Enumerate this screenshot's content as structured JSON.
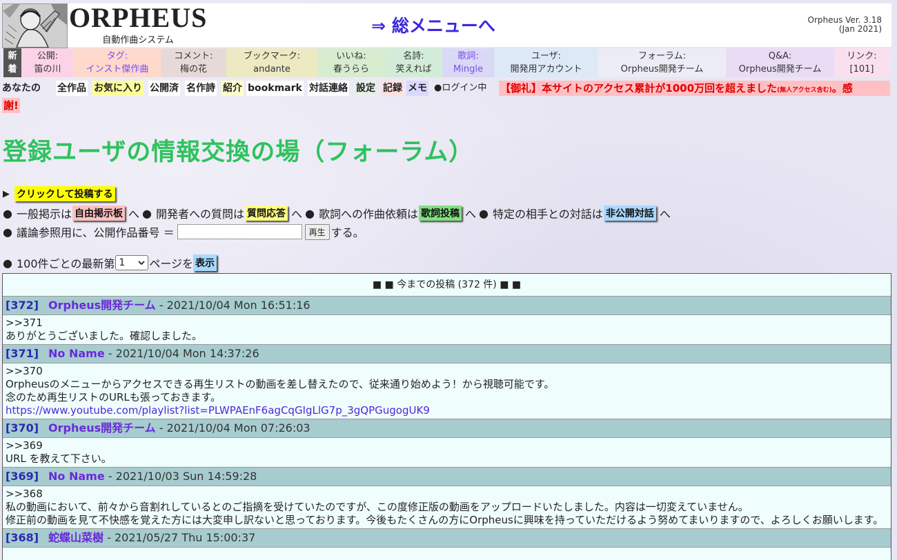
{
  "header": {
    "logo_text": "ORPHEUS",
    "logo_subtitle": "自動作曲システム",
    "total_menu_link": "⇒ 総メニューへ",
    "version_line1": "Orpheus Ver. 3.18",
    "version_line2": "(Jan 2021)"
  },
  "nav": {
    "new": {
      "label1": "新",
      "label2": "着"
    },
    "cells": [
      {
        "label": "公開:",
        "value": "笛の川",
        "bg": "#fcd3e6"
      },
      {
        "label": "タグ:",
        "value": "インスト傑作曲",
        "bg": "#ffd9cc",
        "label_color": "#7a4af0",
        "value_color": "#7a4af0"
      },
      {
        "label": "コメント:",
        "value": "梅の花",
        "bg": "#e8d9d9"
      },
      {
        "label": "ブックマーク:",
        "value": "andante",
        "bg": "#ede9c3"
      },
      {
        "label": "いいね:",
        "value": "春うらら",
        "bg": "#d8ecd0"
      },
      {
        "label": "名詩:",
        "value": "笑えれば",
        "bg": "#d3ecd7"
      },
      {
        "label": "歌詞:",
        "value": "Mingle",
        "bg": "#d9d9f5",
        "label_color": "#7a4af0",
        "value_color": "#7a4af0"
      },
      {
        "label": "ユーザ:",
        "value": "開発用アカウント",
        "bg": "#dde9f7"
      },
      {
        "label": "フォーラム:",
        "value": "Orpheus開発チーム",
        "bg": "#ececf5"
      },
      {
        "label": "Q&A:",
        "value": "Orpheus開発チーム",
        "bg": "#eadcf5"
      },
      {
        "label": "リンク:",
        "value": "[101]",
        "bg": "#fae0ee"
      }
    ]
  },
  "account": {
    "yours": "あなたの",
    "items": [
      {
        "label": "全作品",
        "bg": "#ffffff"
      },
      {
        "label": "お気に入り",
        "bg": "#ffff99"
      },
      {
        "label": "公開済",
        "bg": "#ffffff"
      },
      {
        "label": "名作詩",
        "bg": "#ffffff"
      },
      {
        "label": "紹介",
        "bg": "#ffffcc"
      },
      {
        "label": "bookmark",
        "bg": "#ffffff"
      },
      {
        "label": "対話連絡",
        "bg": "#ffffff"
      },
      {
        "label": "設定",
        "bg": "#e6f0e6"
      },
      {
        "label": "記録",
        "bg": "#ffe0e0"
      },
      {
        "label": "メモ",
        "bg": "#d9d9ff"
      }
    ],
    "login_status": "●ログイン中",
    "notice_main": "【御礼】本サイトのアクセス累計が1000万回を超えました",
    "notice_small": "(無人アクセス含む)",
    "notice_tail": "。感",
    "notice_line2": "謝!"
  },
  "page": {
    "title": "登録ユーザの情報交換の場（フォーラム）"
  },
  "post_link": {
    "arrow": "▶",
    "label": "クリックして投稿する"
  },
  "guide": {
    "bullet": "●",
    "t1": "一般掲示は",
    "tag_free": "自由掲示板",
    "t2": "へ",
    "t3": "開発者への質問は",
    "tag_qa": "質問応答",
    "t4": "へ",
    "t5": "歌詞への作曲依頼は",
    "tag_lyric": "歌詞投稿",
    "t6": "へ",
    "t7": "特定の相手との対話は",
    "tag_private": "非公開対話",
    "t8": "へ"
  },
  "work_ref": {
    "label": "議論参照用に、公開作品番号 ＝",
    "input_value": "",
    "play_button": "再生",
    "suffix": "する。"
  },
  "paging": {
    "label": "100件ごとの最新第",
    "selected_page": "1",
    "suffix": "ページを",
    "show_button": "表示"
  },
  "posts": {
    "header": "■ ■  今までの投稿 (372 件) ■ ■",
    "items": [
      {
        "num": "[372]",
        "author": "Orpheus開発チーム",
        "date": " - 2021/10/04 Mon 16:51:16",
        "lines": [
          ">>371",
          "ありがとうございました。確認しました。"
        ],
        "link": ""
      },
      {
        "num": "[371]",
        "author": "No Name",
        "date": " - 2021/10/04 Mon 14:37:26",
        "lines": [
          ">>370",
          "Orpheusのメニューからアクセスできる再生リストの動画を差し替えたので、従来通り始めよう！から視聴可能です。",
          "念のため再生リストのURLも張っておきます。"
        ],
        "link": "https://www.youtube.com/playlist?list=PLWPAEnF6agCqGIgLlG7p_3gQPGugogUK9"
      },
      {
        "num": "[370]",
        "author": "Orpheus開発チーム",
        "date": " - 2021/10/04 Mon 07:26:03",
        "lines": [
          ">>369",
          "URL を教えて下さい。"
        ],
        "link": ""
      },
      {
        "num": "[369]",
        "author": "No Name",
        "date": " - 2021/10/03 Sun 14:59:28",
        "lines": [
          ">>368",
          "私の動画において、前々から音割れしているとのご指摘を受けていたのですが、この度修正版の動画をアップロードいたしました。内容は一切変えていません。",
          "修正前の動画を見て不快感を覚えた方には大変申し訳ないと思っております。今後もたくさんの方にOrpheusに興味を持っていただけるよう努めてまいりますので、よろしくお願いします。"
        ],
        "link": ""
      },
      {
        "num": "[368]",
        "author": "蛇蝶山菜樹",
        "date": " - 2021/05/27 Thu 15:00:37",
        "lines": [],
        "link": ""
      }
    ]
  }
}
